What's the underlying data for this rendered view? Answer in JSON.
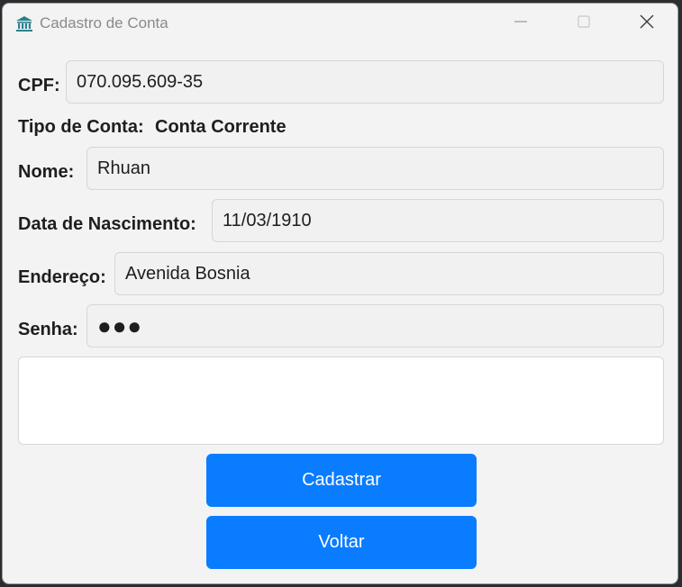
{
  "window": {
    "title": "Cadastro de Conta",
    "app_icon": "bank-icon",
    "controls": [
      "minimize-icon",
      "maximize-icon",
      "close-icon"
    ]
  },
  "form": {
    "cpf": {
      "label": "CPF:",
      "value": "070.095.609-35"
    },
    "tipo_conta": {
      "label": "Tipo de Conta:",
      "value": "Conta Corrente"
    },
    "nome": {
      "label": "Nome:",
      "value": "Rhuan"
    },
    "data_nascimento": {
      "label": "Data de Nascimento:",
      "value": "11/03/1910"
    },
    "endereco": {
      "label": "Endereço:",
      "value": "Avenida Bosnia"
    },
    "senha": {
      "label": "Senha:",
      "value": "●●●"
    },
    "output_text": ""
  },
  "buttons": {
    "cadastrar": "Cadastrar",
    "voltar": "Voltar"
  },
  "colors": {
    "accent": "#0a7cff",
    "window_bg": "#f3f3f3",
    "field_bg": "#f1f1f1",
    "icon_teal": "#2c7f8c"
  }
}
